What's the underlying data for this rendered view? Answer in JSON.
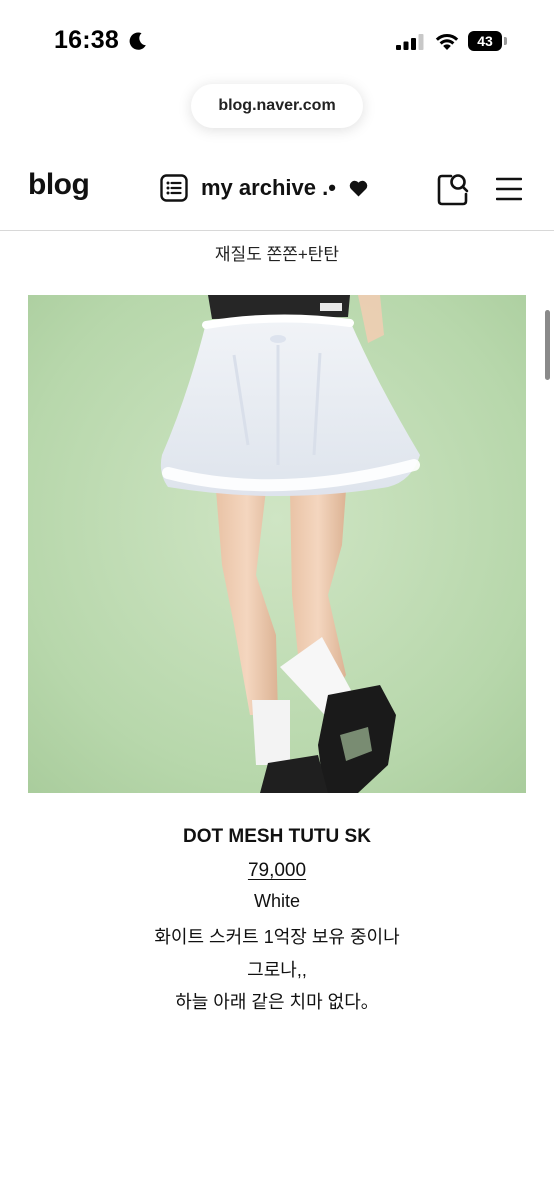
{
  "status_bar": {
    "time": "16:38",
    "battery_level": "43",
    "icons": [
      "moon-icon",
      "signal-icon",
      "wifi-icon",
      "battery-icon"
    ]
  },
  "browser": {
    "url": "blog.naver.com"
  },
  "header": {
    "logo": "blog",
    "title": "my archive .•",
    "icons": [
      "menu-list-icon",
      "heart-icon",
      "search-icon",
      "hamburger-icon"
    ]
  },
  "post": {
    "caption_top": "재질도 쫀쫀+탄탄",
    "product_name": "DOT MESH TUTU SK",
    "price": "79,000",
    "lines": [
      "White",
      "화이트 스커트 1억장 보유 중이나",
      "그로나,,",
      "하늘 아래 같은 치마 없다。"
    ]
  },
  "colors": {
    "photo_background": "#b9d9ad",
    "text": "#111111",
    "divider": "#d8d8d8"
  }
}
